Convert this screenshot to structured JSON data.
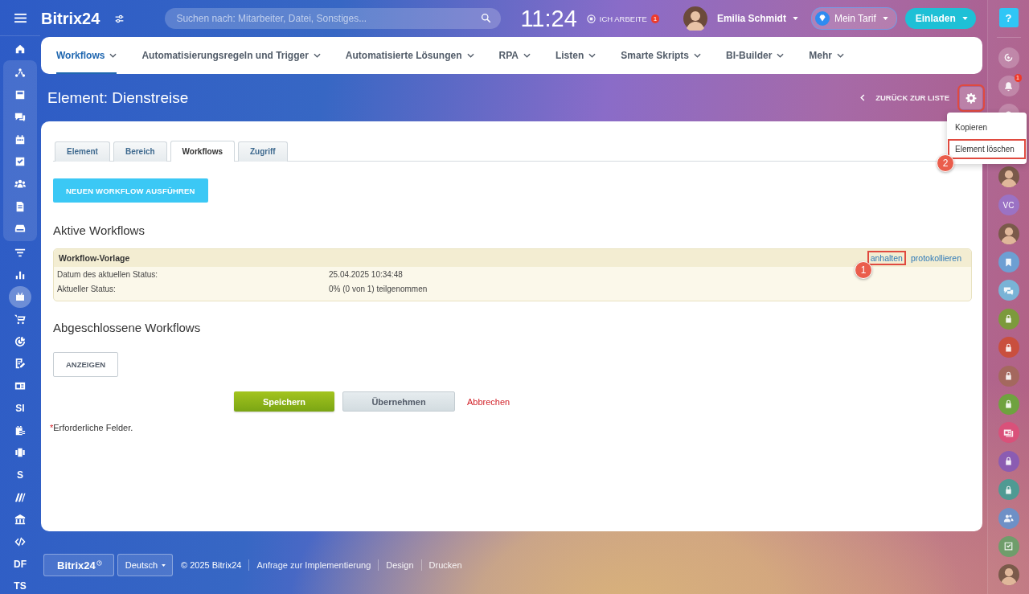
{
  "header": {
    "logo": "Bitrix24",
    "search": {
      "placeholder": "Suchen nach: Mitarbeiter, Datei, Sonstiges..."
    },
    "clock": "11:24",
    "work_status": "ICH ARBEITE",
    "work_badge": "1",
    "user_name": "Emilia Schmidt",
    "tariff": "Mein Tarif",
    "invite": "Einladen",
    "help": "?"
  },
  "left_sidebar": {
    "items": [
      {
        "kind": "icon",
        "selected": false
      },
      {
        "kind": "group",
        "children": [
          {
            "kind": "icon",
            "selected": false
          },
          {
            "kind": "icon",
            "selected": false
          },
          {
            "kind": "icon",
            "selected": false
          },
          {
            "kind": "icon",
            "selected": false
          },
          {
            "kind": "icon",
            "selected": false
          },
          {
            "kind": "icon",
            "selected": false
          },
          {
            "kind": "icon",
            "selected": false
          },
          {
            "kind": "icon",
            "selected": false
          }
        ]
      },
      {
        "kind": "icon",
        "selected": false
      },
      {
        "kind": "icon",
        "selected": false
      },
      {
        "kind": "icon",
        "selected": true
      },
      {
        "kind": "icon",
        "selected": false
      },
      {
        "kind": "icon",
        "selected": false
      },
      {
        "kind": "icon",
        "selected": false
      },
      {
        "kind": "icon",
        "selected": false
      },
      {
        "kind": "text",
        "label": "SI",
        "selected": false
      },
      {
        "kind": "icon",
        "selected": false
      },
      {
        "kind": "icon",
        "selected": false
      },
      {
        "kind": "text",
        "label": "S",
        "selected": false
      },
      {
        "kind": "icon",
        "selected": false
      },
      {
        "kind": "icon",
        "selected": false
      },
      {
        "kind": "icon",
        "selected": false
      },
      {
        "kind": "text",
        "label": "DF",
        "selected": false
      },
      {
        "kind": "text",
        "label": "TS",
        "selected": false
      }
    ]
  },
  "nav": {
    "tabs": [
      {
        "label": "Workflows",
        "selected": true
      },
      {
        "label": "Automatisierungsregeln und Trigger",
        "selected": false
      },
      {
        "label": "Automatisierte Lösungen",
        "selected": false
      },
      {
        "label": "RPA",
        "selected": false
      },
      {
        "label": "Listen",
        "selected": false
      },
      {
        "label": "Smarte Skripts",
        "selected": false
      },
      {
        "label": "BI-Builder",
        "selected": false
      },
      {
        "label": "Mehr",
        "selected": false
      }
    ]
  },
  "page": {
    "title": "Element: Dienstreise",
    "back_link": "ZURÜCK ZUR LISTE",
    "settings_highlighted": true
  },
  "menu": {
    "items": [
      {
        "label": "Kopieren",
        "highlighted": false
      },
      {
        "label": "Element löschen",
        "highlighted": true
      }
    ]
  },
  "card": {
    "tabs": [
      {
        "label": "Element",
        "selected": false
      },
      {
        "label": "Bereich",
        "selected": false
      },
      {
        "label": "Workflows",
        "selected": true
      },
      {
        "label": "Zugriff",
        "selected": false
      }
    ],
    "run_button": "NEUEN WORKFLOW AUSFÜHREN",
    "active_heading": "Aktive Workflows",
    "workflow": {
      "title": "Workflow-Vorlage",
      "actions": [
        {
          "label": "anhalten",
          "highlighted": true
        },
        {
          "label": "protokollieren",
          "highlighted": false
        }
      ],
      "rows": [
        {
          "label": "Datum des aktuellen Status:",
          "value": "25.04.2025 10:34:48"
        },
        {
          "label": "Aktueller Status:",
          "value": "0% (0 von 1) teilgenommen"
        }
      ]
    },
    "completed_heading": "Abgeschlossene Workflows",
    "show_button": "ANZEIGEN",
    "save": "Speichern",
    "apply": "Übernehmen",
    "cancel": "Abbrechen",
    "required_mark": "*",
    "required_note": "Erforderliche Felder."
  },
  "annotations": [
    {
      "label": "1"
    },
    {
      "label": "2"
    }
  ],
  "footer": {
    "logo": "Bitrix24",
    "language": "Deutsch",
    "copyright": "© 2025 Bitrix24",
    "links": [
      "Anfrage zur Implementierung",
      "Design",
      "Drucken"
    ]
  },
  "right_sidebar": {
    "items": [
      {
        "kind": "icon"
      },
      {
        "kind": "icon",
        "badge": "1"
      },
      {
        "kind": "icon"
      },
      {
        "kind": "avatar"
      },
      {
        "kind": "initials",
        "label": "VC",
        "color": "#9b72c4"
      },
      {
        "kind": "avatar"
      },
      {
        "kind": "icon",
        "color": "#6d9fd3"
      },
      {
        "kind": "icon",
        "color": "#79b3d6"
      },
      {
        "kind": "icon",
        "color": "#7c9a3c"
      },
      {
        "kind": "icon",
        "color": "#c94f3e"
      },
      {
        "kind": "icon",
        "color": "#a4685e"
      },
      {
        "kind": "icon",
        "color": "#6fa23f"
      },
      {
        "kind": "icon",
        "color": "#d9517a"
      },
      {
        "kind": "icon",
        "color": "#8b5cb2"
      },
      {
        "kind": "icon",
        "color": "#4f9a93"
      },
      {
        "kind": "icon",
        "color": "#6e90c6"
      },
      {
        "kind": "icon",
        "color": "#6f9d6b"
      },
      {
        "kind": "avatar"
      }
    ]
  }
}
